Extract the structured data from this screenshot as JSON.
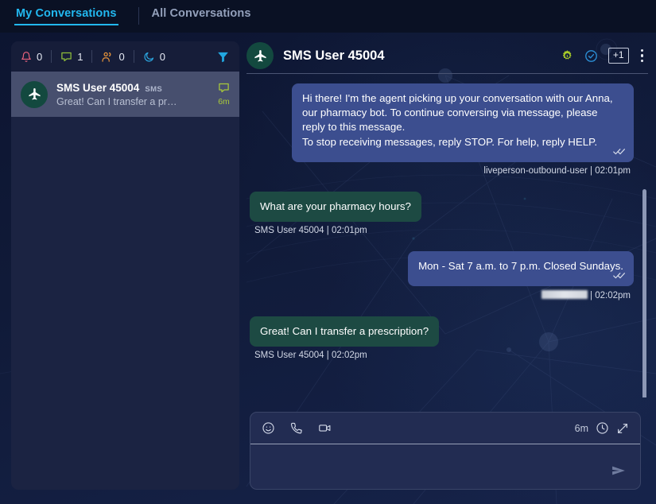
{
  "tabs": [
    {
      "label": "My Conversations",
      "active": true
    },
    {
      "label": "All Conversations",
      "active": false
    }
  ],
  "sidebar": {
    "filters": [
      {
        "icon": "bell-icon",
        "count": "0",
        "color": "#e8627d"
      },
      {
        "icon": "chat-bubble-icon",
        "count": "1",
        "color": "#8fbe3a"
      },
      {
        "icon": "people-icon",
        "count": "0",
        "color": "#e8943a"
      },
      {
        "icon": "moon-icon",
        "count": "0",
        "color": "#2ba6e0"
      }
    ],
    "filter_button": "filter-funnel-icon",
    "conversations": [
      {
        "avatar_icon": "airplane-icon",
        "name": "SMS User 45004",
        "channel": "SMS",
        "preview": "Great! Can I transfer a pr…",
        "status_icon": "chat-bubble-icon",
        "time": "6m",
        "selected": true
      }
    ]
  },
  "header": {
    "avatar_icon": "airplane-icon",
    "title": "SMS User 45004",
    "gear_badge": "1",
    "plus_label": "+1",
    "icons": [
      "gear-icon",
      "check-circle-icon",
      "add-participant-button",
      "more-options-icon"
    ]
  },
  "messages": [
    {
      "direction": "out",
      "text": "Hi there! I'm the agent picking up your conversation with our Anna, our pharmacy bot. To continue conversing via message, please reply to this message.\nTo stop receiving messages, reply STOP. For help, reply HELP.",
      "sender": "liveperson-outbound-user",
      "separator": "|",
      "time": "02:01pm",
      "read_receipt": true,
      "redacted_sender": false
    },
    {
      "direction": "in",
      "text": "What are your pharmacy hours?",
      "sender": "SMS User 45004",
      "separator": "|",
      "time": "02:01pm",
      "read_receipt": false,
      "redacted_sender": false
    },
    {
      "direction": "out",
      "text": "Mon - Sat 7 a.m. to 7 p.m. Closed Sundays.",
      "sender": "",
      "separator": "|",
      "time": "02:02pm",
      "read_receipt": true,
      "redacted_sender": true
    },
    {
      "direction": "in",
      "text": "Great! Can I transfer a prescription?",
      "sender": "SMS User 45004",
      "separator": "|",
      "time": "02:02pm",
      "read_receipt": false,
      "redacted_sender": false
    }
  ],
  "composer": {
    "left_icons": [
      "emoji-icon",
      "phone-icon",
      "video-icon"
    ],
    "timer_label": "6m",
    "clock_icon": "clock-icon",
    "expand_icon": "expand-icon",
    "send_icon": "send-icon",
    "input_value": "",
    "input_placeholder": ""
  },
  "colors": {
    "accent": "#22b8f0",
    "inbound_bubble": "#1d4a43",
    "outbound_bubble": "#3c4e8f",
    "list_time": "#a9c93a"
  }
}
